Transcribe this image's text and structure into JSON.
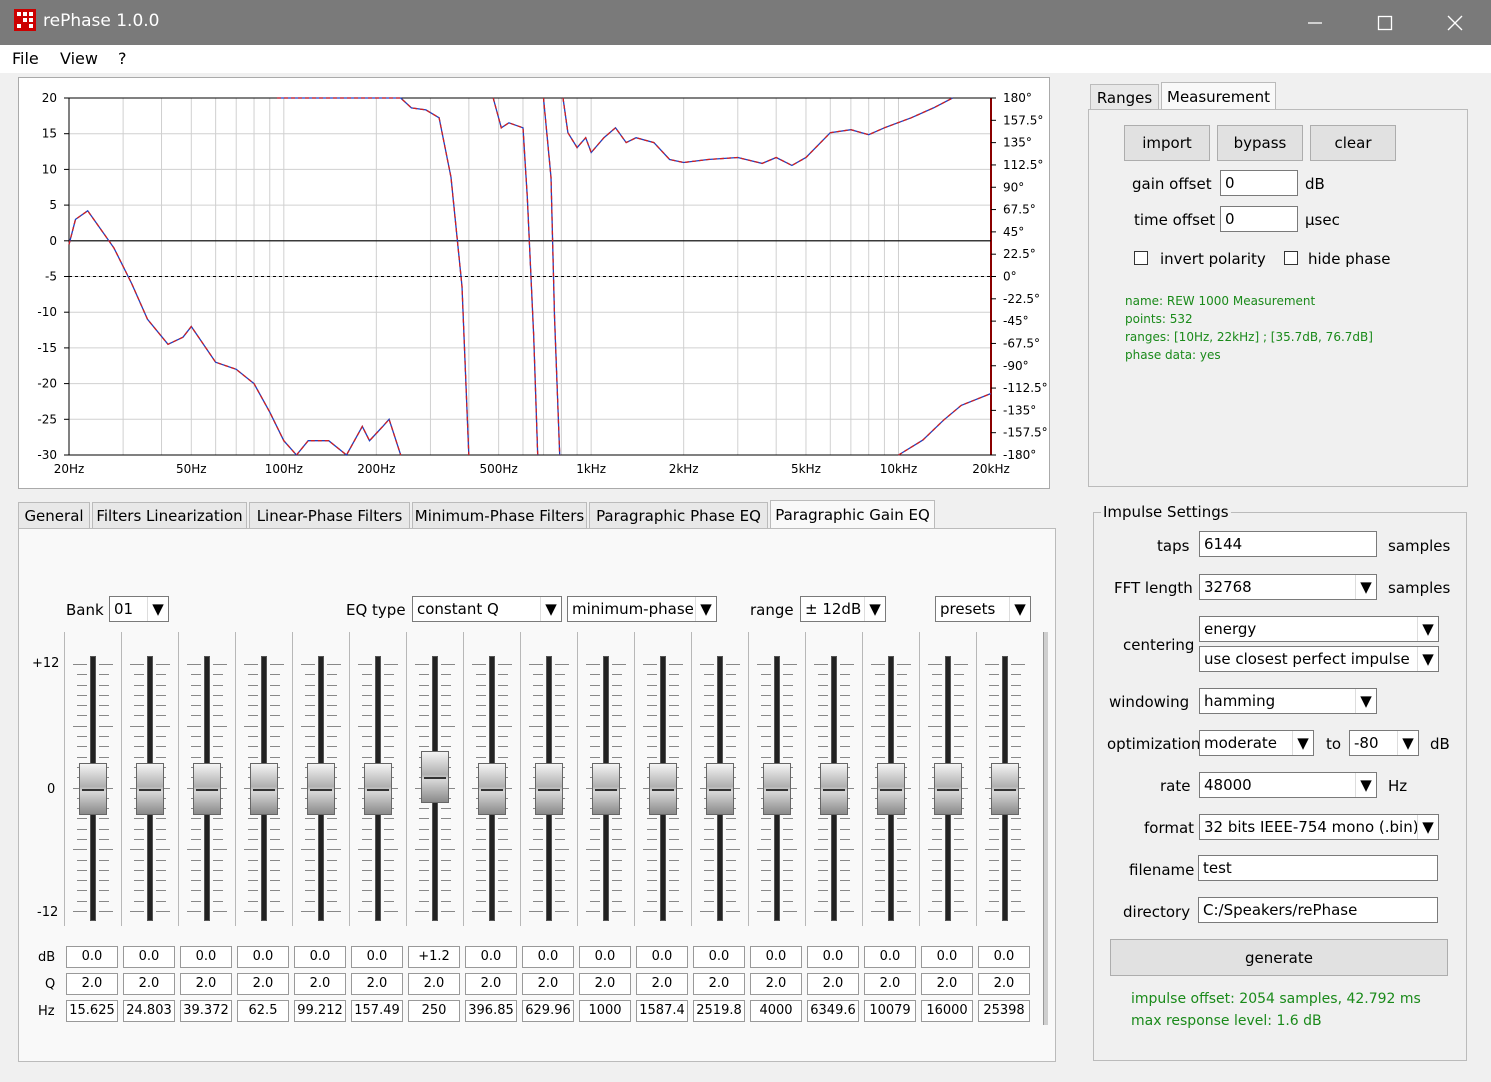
{
  "window": {
    "title": "rePhase 1.0.0"
  },
  "menu": [
    "File",
    "View",
    "?"
  ],
  "plot": {
    "y_left_ticks": [
      "20",
      "15",
      "10",
      "5",
      "0",
      "-5",
      "-10",
      "-15",
      "-20",
      "-25",
      "-30"
    ],
    "y_right_ticks": [
      "180°",
      "157.5°",
      "135°",
      "112.5°",
      "90°",
      "67.5°",
      "45°",
      "22.5°",
      "0°",
      "-22.5°",
      "-45°",
      "-67.5°",
      "-90°",
      "-112.5°",
      "-135°",
      "-157.5°",
      "-180°"
    ],
    "x_ticks": [
      "20Hz",
      "50Hz",
      "100Hz",
      "200Hz",
      "500Hz",
      "1kHz",
      "2kHz",
      "5kHz",
      "10kHz",
      "20kHz"
    ],
    "x_tick_values": [
      20,
      50,
      100,
      200,
      500,
      1000,
      2000,
      5000,
      10000,
      20000
    ],
    "ylim": [
      -30,
      20
    ],
    "xlim": [
      20,
      20000
    ],
    "x_scale": "log",
    "reference_line_db": -5,
    "magnitude_curve": [
      [
        20,
        -0.5
      ],
      [
        21,
        3
      ],
      [
        23,
        4.2
      ],
      [
        25,
        2
      ],
      [
        28,
        -1
      ],
      [
        32,
        -6
      ],
      [
        36,
        -11
      ],
      [
        42,
        -14.5
      ],
      [
        47,
        -13.5
      ],
      [
        50,
        -12
      ],
      [
        60,
        -17
      ],
      [
        70,
        -18
      ],
      [
        80,
        -20
      ],
      [
        90,
        -24
      ],
      [
        100,
        -28
      ],
      [
        110,
        -30.5
      ],
      [
        120,
        -28
      ],
      [
        140,
        -28
      ],
      [
        160,
        -30
      ],
      [
        180,
        -26
      ],
      [
        190,
        -28
      ],
      [
        210,
        -26
      ],
      [
        220,
        -25
      ],
      [
        240,
        -31
      ]
    ],
    "phase_curve": [
      [
        95,
        180
      ],
      [
        100,
        181
      ],
      [
        240,
        180
      ],
      [
        260,
        170
      ],
      [
        290,
        168
      ],
      [
        320,
        160
      ],
      [
        350,
        100
      ],
      [
        380,
        -10
      ],
      [
        400,
        -180
      ]
    ],
    "phase_curve_2": [
      [
        480,
        190
      ],
      [
        510,
        150
      ],
      [
        540,
        155
      ],
      [
        600,
        150
      ],
      [
        620,
        80
      ],
      [
        650,
        -60
      ],
      [
        670,
        -180
      ]
    ],
    "phase_curve_3": [
      [
        700,
        190
      ],
      [
        740,
        100
      ],
      [
        760,
        -40
      ],
      [
        790,
        -180
      ]
    ],
    "phase_curve_4": [
      [
        810,
        180
      ],
      [
        840,
        145
      ],
      [
        900,
        130
      ],
      [
        960,
        140
      ],
      [
        1000,
        125
      ],
      [
        1100,
        140
      ],
      [
        1200,
        150
      ],
      [
        1300,
        135
      ],
      [
        1400,
        140
      ],
      [
        1600,
        135
      ],
      [
        1800,
        118
      ],
      [
        2000,
        115
      ],
      [
        2400,
        118
      ],
      [
        3000,
        120
      ],
      [
        3600,
        114
      ],
      [
        4000,
        120
      ],
      [
        4500,
        112
      ],
      [
        5000,
        120
      ],
      [
        6000,
        145
      ],
      [
        7000,
        148
      ],
      [
        8000,
        143
      ],
      [
        9000,
        150
      ],
      [
        11000,
        160
      ],
      [
        13000,
        170
      ],
      [
        15000,
        182
      ]
    ],
    "phase_curve_5": [
      [
        10000,
        -180
      ],
      [
        12000,
        -165
      ],
      [
        14000,
        -145
      ],
      [
        16000,
        -130
      ],
      [
        20000,
        -118
      ]
    ],
    "colors": {
      "magnitude": "#d22020",
      "phase": "#2040c0",
      "mirror": "#8a0000"
    }
  },
  "right_tabs": {
    "tabs": [
      "Ranges",
      "Measurement"
    ],
    "active": "Measurement"
  },
  "measurement": {
    "import": "import",
    "bypass": "bypass",
    "clear": "clear",
    "gain_offset_label": "gain offset",
    "gain_offset_value": "0",
    "gain_offset_unit": "dB",
    "time_offset_label": "time offset",
    "time_offset_value": "0",
    "time_offset_unit": "µsec",
    "invert_polarity": "invert polarity",
    "hide_phase": "hide phase",
    "info": [
      "name: REW 1000 Measurement",
      "points: 532",
      "ranges: [10Hz, 22kHz] ; [35.7dB, 76.7dB]",
      "phase data: yes"
    ]
  },
  "bottom_tabs": {
    "tabs": [
      "General",
      "Filters Linearization",
      "Linear-Phase Filters",
      "Minimum-Phase Filters",
      "Paragraphic Phase EQ",
      "Paragraphic Gain EQ"
    ],
    "active": "Paragraphic Gain EQ"
  },
  "eq": {
    "bank_label": "Bank",
    "bank_value": "01",
    "eq_type_label": "EQ type",
    "eq_type_value": "constant Q",
    "phase_type_value": "minimum-phase",
    "range_label": "range",
    "range_value": "± 12dB",
    "presets": "presets",
    "scale": {
      "top": "+12",
      "mid": "0",
      "bottom": "-12"
    },
    "row_labels": {
      "db": "dB",
      "q": "Q",
      "hz": "Hz"
    },
    "bands": [
      {
        "db": "0.0",
        "q": "2.0",
        "hz": "15.625",
        "gain": 0
      },
      {
        "db": "0.0",
        "q": "2.0",
        "hz": "24.803",
        "gain": 0
      },
      {
        "db": "0.0",
        "q": "2.0",
        "hz": "39.372",
        "gain": 0
      },
      {
        "db": "0.0",
        "q": "2.0",
        "hz": "62.5",
        "gain": 0
      },
      {
        "db": "0.0",
        "q": "2.0",
        "hz": "99.212",
        "gain": 0
      },
      {
        "db": "0.0",
        "q": "2.0",
        "hz": "157.49",
        "gain": 0
      },
      {
        "db": "+1.2",
        "q": "2.0",
        "hz": "250",
        "gain": 1.2
      },
      {
        "db": "0.0",
        "q": "2.0",
        "hz": "396.85",
        "gain": 0
      },
      {
        "db": "0.0",
        "q": "2.0",
        "hz": "629.96",
        "gain": 0
      },
      {
        "db": "0.0",
        "q": "2.0",
        "hz": "1000",
        "gain": 0
      },
      {
        "db": "0.0",
        "q": "2.0",
        "hz": "1587.4",
        "gain": 0
      },
      {
        "db": "0.0",
        "q": "2.0",
        "hz": "2519.8",
        "gain": 0
      },
      {
        "db": "0.0",
        "q": "2.0",
        "hz": "4000",
        "gain": 0
      },
      {
        "db": "0.0",
        "q": "2.0",
        "hz": "6349.6",
        "gain": 0
      },
      {
        "db": "0.0",
        "q": "2.0",
        "hz": "10079",
        "gain": 0
      },
      {
        "db": "0.0",
        "q": "2.0",
        "hz": "16000",
        "gain": 0
      },
      {
        "db": "0.0",
        "q": "2.0",
        "hz": "25398",
        "gain": 0
      }
    ]
  },
  "impulse": {
    "title": "Impulse Settings",
    "taps_label": "taps",
    "taps_value": "6144",
    "taps_unit": "samples",
    "fft_label": "FFT length",
    "fft_value": "32768",
    "fft_unit": "samples",
    "centering_label": "centering",
    "centering_value": "energy",
    "centering_mode": "use closest perfect impulse",
    "windowing_label": "windowing",
    "windowing_value": "hamming",
    "optimization_label": "optimization",
    "optimization_value": "moderate",
    "to_label": "to",
    "optimization_db": "-80",
    "db_unit": "dB",
    "rate_label": "rate",
    "rate_value": "48000",
    "rate_unit": "Hz",
    "format_label": "format",
    "format_value": "32 bits IEEE-754 mono (.bin)",
    "filename_label": "filename",
    "filename_value": "test",
    "directory_label": "directory",
    "directory_value": "C:/Speakers/rePhase",
    "generate": "generate",
    "status_offset": "impulse offset: 2054 samples, 42.792 ms",
    "status_level": "max response level: 1.6 dB"
  }
}
